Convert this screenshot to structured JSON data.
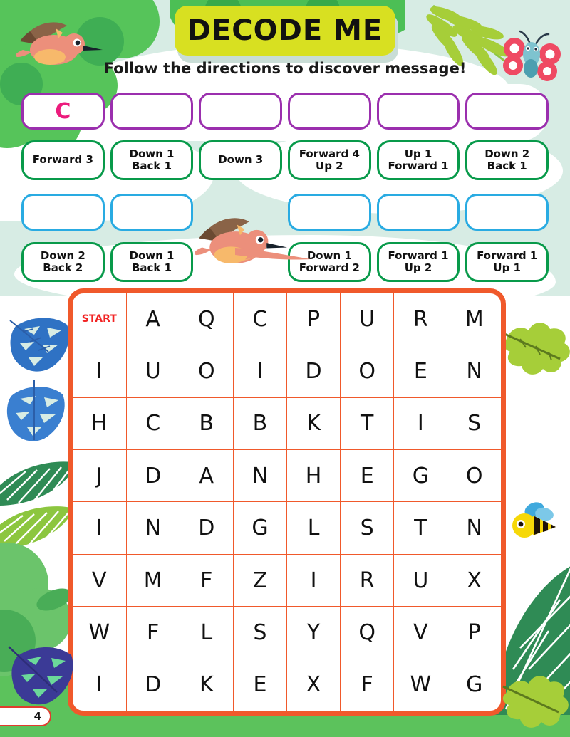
{
  "page": {
    "title": "DECODE ME",
    "subtitle": "Follow the directions to discover message!",
    "page_number": "4",
    "colors": {
      "banner": "#d8e021",
      "answer_border_row1": "#9b2fae",
      "answer_border_row2": "#29abe2",
      "direction_border": "#089a4a",
      "grid_border": "#f0592b",
      "start_label": "#f22424",
      "answer_letter": "#ec1c7d",
      "bottom_band": "#5cc25c",
      "mint_background": "#d7ece4"
    }
  },
  "answers": {
    "row1": [
      {
        "letter": "C"
      },
      {
        "letter": ""
      },
      {
        "letter": ""
      },
      {
        "letter": ""
      },
      {
        "letter": ""
      },
      {
        "letter": ""
      }
    ],
    "row2": [
      {
        "letter": ""
      },
      {
        "letter": ""
      },
      {
        "letter": "",
        "hidden": true
      },
      {
        "letter": ""
      },
      {
        "letter": ""
      },
      {
        "letter": ""
      }
    ]
  },
  "directions": {
    "row1": [
      "Forward 3",
      "Down 1\nBack 1",
      "Down 3",
      "Forward 4\nUp 2",
      "Up 1\nForward 1",
      "Down 2\nBack 1"
    ],
    "row2": [
      "Down 2\nBack 2",
      "Down 1\nBack 1",
      "",
      "Down 1\nForward 2",
      "Forward 1\nUp 2",
      "Forward 1\nUp 1"
    ]
  },
  "grid": {
    "start_label": "START",
    "columns": 8,
    "rows": 8,
    "cells": [
      [
        "START",
        "A",
        "Q",
        "C",
        "P",
        "U",
        "R",
        "M"
      ],
      [
        "I",
        "U",
        "O",
        "I",
        "D",
        "O",
        "E",
        "N"
      ],
      [
        "H",
        "C",
        "B",
        "B",
        "K",
        "T",
        "I",
        "S"
      ],
      [
        "J",
        "D",
        "A",
        "N",
        "H",
        "E",
        "G",
        "O"
      ],
      [
        "I",
        "N",
        "D",
        "G",
        "L",
        "S",
        "T",
        "N"
      ],
      [
        "V",
        "M",
        "F",
        "Z",
        "I",
        "R",
        "U",
        "X"
      ],
      [
        "W",
        "F",
        "L",
        "S",
        "Y",
        "Q",
        "V",
        "P"
      ],
      [
        "I",
        "D",
        "K",
        "E",
        "X",
        "F",
        "W",
        "G"
      ]
    ]
  },
  "decorations": [
    {
      "name": "hummingbird-top-left"
    },
    {
      "name": "hummingbird-middle"
    },
    {
      "name": "butterfly-top-right"
    },
    {
      "name": "bee-right"
    },
    {
      "name": "palm-frond-top-right"
    },
    {
      "name": "monstera-leaf-left-upper"
    },
    {
      "name": "monstera-leaf-left-lower"
    },
    {
      "name": "monstera-leaf-bottom-left"
    },
    {
      "name": "oak-leaf-right-upper"
    },
    {
      "name": "oak-leaf-bottom-right"
    },
    {
      "name": "striped-leaf-left"
    },
    {
      "name": "striped-leaf-bottom-right"
    }
  ]
}
